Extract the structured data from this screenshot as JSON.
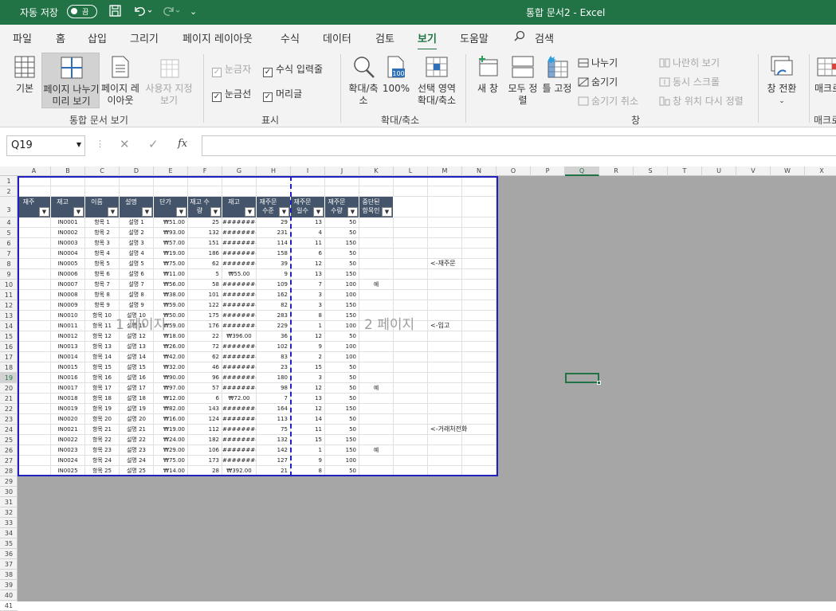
{
  "titlebar": {
    "autosave": "자동 저장",
    "toggle": "끔",
    "title": "통합 문서2  -  Excel",
    "icons": [
      "save-icon",
      "undo-icon",
      "redo-icon",
      "customize-icon"
    ]
  },
  "menu": [
    "파일",
    "홈",
    "삽입",
    "그리기",
    "페이지 레이아웃",
    "수식",
    "데이터",
    "검토",
    "보기",
    "도움말",
    "검색"
  ],
  "ribbon": {
    "views": [
      "기본",
      "페이지 나누기 미리 보기",
      "페이지 레이아웃",
      "사용자 지정 보기"
    ],
    "group_views": "통합 문서 보기",
    "show": {
      "ruler": "눈금자",
      "formula_bar": "수식 입력줄",
      "gridlines": "눈금선",
      "headings": "머리글"
    },
    "group_show": "표시",
    "zoom": [
      "확대/축소",
      "100%",
      "선택 영역 확대/축소"
    ],
    "group_zoom": "확대/축소",
    "window": {
      "new": "새 창",
      "arrange": "모두 정렬",
      "freeze": "틀 고정",
      "split": "나누기",
      "hide": "숨기기",
      "unhide": "숨기기 취소",
      "side_by_side": "나란히 보기",
      "sync_scroll": "동시 스크롤",
      "reset_pos": "창 위치 다시 정렬",
      "switch": "창 전환"
    },
    "group_window": "창",
    "macro": "매크로",
    "group_macro": "매크로"
  },
  "formula": {
    "namebox": "Q19",
    "fx": "fx",
    "value": ""
  },
  "columns": [
    "A",
    "B",
    "C",
    "D",
    "E",
    "F",
    "G",
    "H",
    "I",
    "J",
    "K",
    "L",
    "M",
    "N",
    "O",
    "P",
    "Q",
    "R",
    "S",
    "T",
    "U",
    "V",
    "W",
    "X"
  ],
  "rows": [
    "1",
    "2",
    "3",
    "4",
    "5",
    "6",
    "7",
    "8",
    "9",
    "10",
    "11",
    "12",
    "13",
    "14",
    "15",
    "16",
    "17",
    "18",
    "19",
    "20",
    "21",
    "22",
    "23",
    "24",
    "25",
    "26",
    "27",
    "28",
    "29",
    "30",
    "31",
    "32",
    "33",
    "34",
    "35",
    "36",
    "37",
    "38",
    "39",
    "40",
    "41"
  ],
  "table_headers": [
    "재주",
    "재고",
    "이름",
    "설명",
    "단가",
    "재고 수량",
    "재고",
    "재주문 수준",
    "재주문 일수",
    "재주문 수량",
    "중단된 항목인"
  ],
  "table_rows": [
    [
      "",
      "IN0001",
      "항목 1",
      "설명 1",
      "₩51.00",
      "25",
      "########",
      "29",
      "13",
      "50",
      ""
    ],
    [
      "",
      "IN0002",
      "항목 2",
      "설명 2",
      "₩93.00",
      "132",
      "########",
      "231",
      "4",
      "50",
      ""
    ],
    [
      "",
      "IN0003",
      "항목 3",
      "설명 3",
      "₩57.00",
      "151",
      "########",
      "114",
      "11",
      "150",
      ""
    ],
    [
      "",
      "IN0004",
      "항목 4",
      "설명 4",
      "₩19.00",
      "186",
      "########",
      "158",
      "6",
      "50",
      ""
    ],
    [
      "",
      "IN0005",
      "항목 5",
      "설명 5",
      "₩75.00",
      "62",
      "########",
      "39",
      "12",
      "50",
      ""
    ],
    [
      "",
      "IN0006",
      "항목 6",
      "설명 6",
      "₩11.00",
      "5",
      "₩55.00",
      "9",
      "13",
      "150",
      ""
    ],
    [
      "",
      "IN0007",
      "항목 7",
      "설명 7",
      "₩56.00",
      "58",
      "########",
      "109",
      "7",
      "100",
      "예"
    ],
    [
      "",
      "IN0008",
      "항목 8",
      "설명 8",
      "₩38.00",
      "101",
      "########",
      "162",
      "3",
      "100",
      ""
    ],
    [
      "",
      "IN0009",
      "항목 9",
      "설명 9",
      "₩59.00",
      "122",
      "########",
      "82",
      "3",
      "150",
      ""
    ],
    [
      "",
      "IN0010",
      "항목 10",
      "설명 10",
      "₩50.00",
      "175",
      "########",
      "283",
      "8",
      "150",
      ""
    ],
    [
      "",
      "IN0011",
      "항목 11",
      "설명 11",
      "₩59.00",
      "176",
      "########",
      "229",
      "1",
      "100",
      ""
    ],
    [
      "",
      "IN0012",
      "항목 12",
      "설명 12",
      "₩18.00",
      "22",
      "₩396.00",
      "36",
      "12",
      "50",
      ""
    ],
    [
      "",
      "IN0013",
      "항목 13",
      "설명 13",
      "₩26.00",
      "72",
      "########",
      "102",
      "9",
      "100",
      ""
    ],
    [
      "",
      "IN0014",
      "항목 14",
      "설명 14",
      "₩42.00",
      "62",
      "########",
      "83",
      "2",
      "100",
      ""
    ],
    [
      "",
      "IN0015",
      "항목 15",
      "설명 15",
      "₩32.00",
      "46",
      "########",
      "23",
      "15",
      "50",
      ""
    ],
    [
      "",
      "IN0016",
      "항목 16",
      "설명 16",
      "₩90.00",
      "96",
      "########",
      "180",
      "3",
      "50",
      ""
    ],
    [
      "",
      "IN0017",
      "항목 17",
      "설명 17",
      "₩97.00",
      "57",
      "########",
      "98",
      "12",
      "50",
      "예"
    ],
    [
      "",
      "IN0018",
      "항목 18",
      "설명 18",
      "₩12.00",
      "6",
      "₩72.00",
      "7",
      "13",
      "50",
      ""
    ],
    [
      "",
      "IN0019",
      "항목 19",
      "설명 19",
      "₩82.00",
      "143",
      "########",
      "164",
      "12",
      "150",
      ""
    ],
    [
      "",
      "IN0020",
      "항목 20",
      "설명 20",
      "₩16.00",
      "124",
      "########",
      "113",
      "14",
      "50",
      ""
    ],
    [
      "",
      "IN0021",
      "항목 21",
      "설명 21",
      "₩19.00",
      "112",
      "########",
      "75",
      "11",
      "50",
      ""
    ],
    [
      "",
      "IN0022",
      "항목 22",
      "설명 22",
      "₩24.00",
      "182",
      "########",
      "132",
      "15",
      "150",
      ""
    ],
    [
      "",
      "IN0023",
      "항목 23",
      "설명 23",
      "₩29.00",
      "106",
      "########",
      "142",
      "1",
      "150",
      "예"
    ],
    [
      "",
      "IN0024",
      "항목 24",
      "설명 24",
      "₩75.00",
      "173",
      "########",
      "127",
      "9",
      "100",
      ""
    ],
    [
      "",
      "IN0025",
      "항목 25",
      "설명 25",
      "₩14.00",
      "28",
      "₩392.00",
      "21",
      "8",
      "50",
      ""
    ]
  ],
  "notes": {
    "reorder": "<-재주문",
    "stock": "<-입고",
    "vendor": "<-거래처전화"
  },
  "watermarks": {
    "page1": "1 페이지",
    "page2": "2 페이지"
  }
}
